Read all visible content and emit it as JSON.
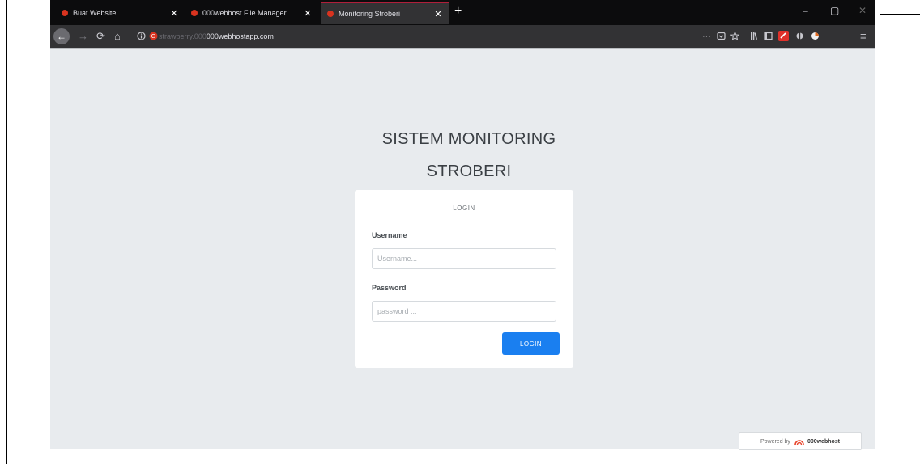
{
  "browser": {
    "tabs": [
      {
        "label": "Buat Website",
        "close": "✕",
        "active": false,
        "favicon_color": "#d9331f"
      },
      {
        "label": "000webhost File Manager",
        "close": "✕",
        "active": false,
        "favicon_color": "#d9331f"
      },
      {
        "label": "Monitoring Stroberi",
        "close": "✕",
        "active": true,
        "favicon_color": "#d9331f"
      }
    ],
    "new_tab": "+",
    "window_controls": {
      "minimize": "–",
      "maximize": "▢",
      "close": "✕"
    },
    "nav": {
      "back": "←",
      "forward": "→",
      "reload": "⟳",
      "home": "⌂"
    },
    "url": {
      "prefix": "strawberry.000",
      "domain": "000webhostapp.com"
    },
    "overflow": "···",
    "menu": "≡"
  },
  "page": {
    "title_line1": "SISTEM MONITORING",
    "title_line2": "STROBERI",
    "card_title": "LOGIN",
    "username_label": "Username",
    "username_placeholder": "Username...",
    "password_label": "Password",
    "password_placeholder": "password ...",
    "login_button": "LOGIN"
  },
  "footer": {
    "powered_by": "Powered by",
    "brand": "000webhost"
  },
  "colors": {
    "tab_accent": "#b01e3a",
    "button": "#1a7ff0",
    "page_bg": "#e8ebee"
  }
}
